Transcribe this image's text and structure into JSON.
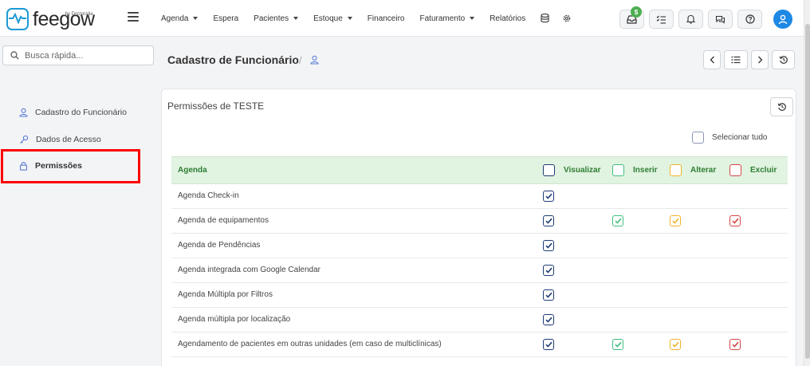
{
  "brand": {
    "name": "feegow",
    "by": "by Doctoralia",
    "accent": "#1d9ad6"
  },
  "nav": {
    "items": [
      {
        "label": "Agenda",
        "dropdown": true
      },
      {
        "label": "Espera",
        "dropdown": false
      },
      {
        "label": "Pacientes",
        "dropdown": true
      },
      {
        "label": "Estoque",
        "dropdown": true
      },
      {
        "label": "Financeiro",
        "dropdown": false
      },
      {
        "label": "Faturamento",
        "dropdown": true
      },
      {
        "label": "Relatórios",
        "dropdown": false
      }
    ],
    "icons": [
      "database-icon",
      "gear-icon"
    ]
  },
  "topbar": {
    "buttons": [
      "inbox-icon",
      "checklist-icon",
      "bell-icon",
      "chat-icon",
      "help-icon"
    ],
    "badge": "$"
  },
  "search": {
    "placeholder": "Busca rápida..."
  },
  "sidebar": {
    "items": [
      {
        "label": "Cadastro do Funcionário",
        "icon": "user-icon"
      },
      {
        "label": "Dados de Acesso",
        "icon": "key-icon"
      },
      {
        "label": "Permissões",
        "icon": "lock-icon",
        "active": true
      }
    ]
  },
  "header": {
    "title": "Cadastro de Funcionário",
    "separator": "/"
  },
  "card": {
    "title": "Permissões de TESTE",
    "select_all": "Selecionar tudo",
    "section": "Agenda",
    "columns": [
      "Visualizar",
      "Inserir",
      "Alterar",
      "Excluir"
    ],
    "rows": [
      {
        "name": "Agenda Check-in",
        "visualizar": true,
        "inserir": null,
        "alterar": null,
        "excluir": null
      },
      {
        "name": "Agenda de equipamentos",
        "visualizar": true,
        "inserir": true,
        "alterar": true,
        "excluir": true
      },
      {
        "name": "Agenda de Pendências",
        "visualizar": true,
        "inserir": null,
        "alterar": null,
        "excluir": null
      },
      {
        "name": "Agenda integrada com Google Calendar",
        "visualizar": true,
        "inserir": null,
        "alterar": null,
        "excluir": null
      },
      {
        "name": "Agenda Múltipla por Filtros",
        "visualizar": true,
        "inserir": null,
        "alterar": null,
        "excluir": null
      },
      {
        "name": "Agenda múltipla por localização",
        "visualizar": true,
        "inserir": null,
        "alterar": null,
        "excluir": null
      },
      {
        "name": "Agendamento de pacientes em outras unidades (em caso de multiclínicas)",
        "visualizar": true,
        "inserir": true,
        "alterar": true,
        "excluir": true
      }
    ]
  },
  "colors": {
    "visualizar": "#1f3b73",
    "inserir": "#3fbf7f",
    "alterar": "#f0b429",
    "excluir": "#d64545",
    "highlight": "#ff0000"
  }
}
